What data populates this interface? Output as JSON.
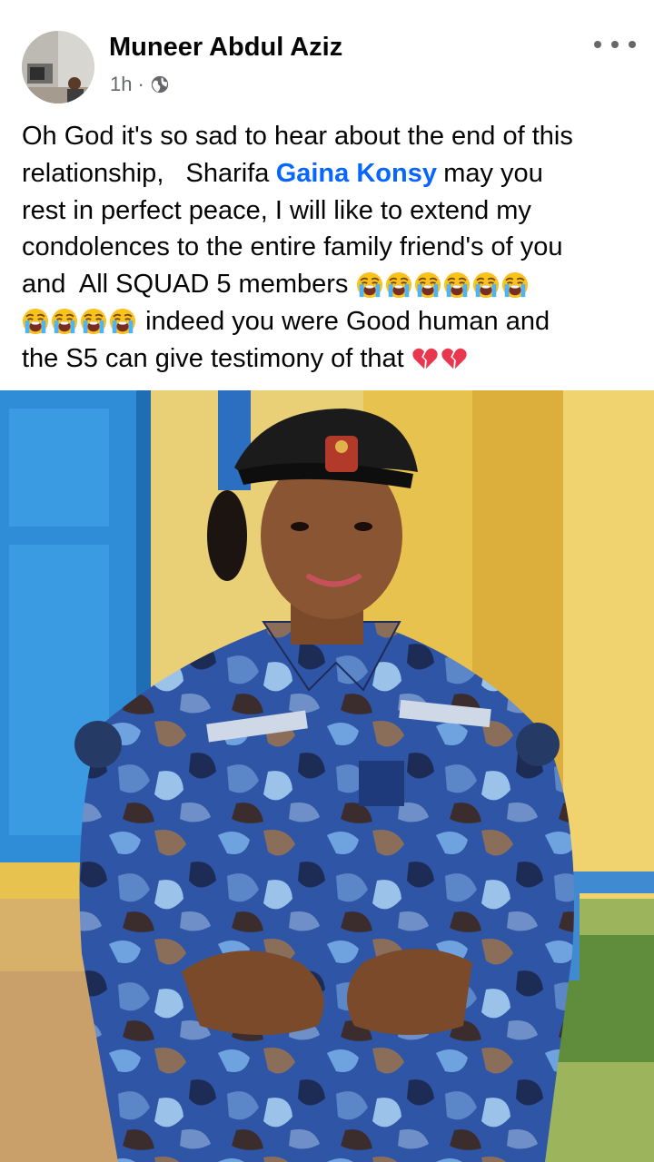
{
  "post": {
    "author_name": "Muneer Abdul Aziz",
    "timestamp": "1h",
    "separator": "·",
    "privacy_icon": "globe-icon",
    "more_icon": "more-options-icon",
    "text": {
      "line1": "Oh God it's so sad to hear about the end of this",
      "line2_a": "relationship,   Sharifa",
      "mention": "Gaina Konsy",
      "line2_b": "may you",
      "line3": "rest in perfect peace, I will like to extend my",
      "line4": "condolences to the entire family friend's of you",
      "line5": "and  All SQUAD 5 members",
      "line6": "indeed you were Good human and",
      "line7": "the S5 can give testimony of that"
    },
    "emojis": {
      "crying_face": "loudly-crying-face",
      "broken_heart": "broken-heart"
    },
    "colors": {
      "mention": "#0866ff",
      "secondary_text": "#65676b"
    }
  }
}
